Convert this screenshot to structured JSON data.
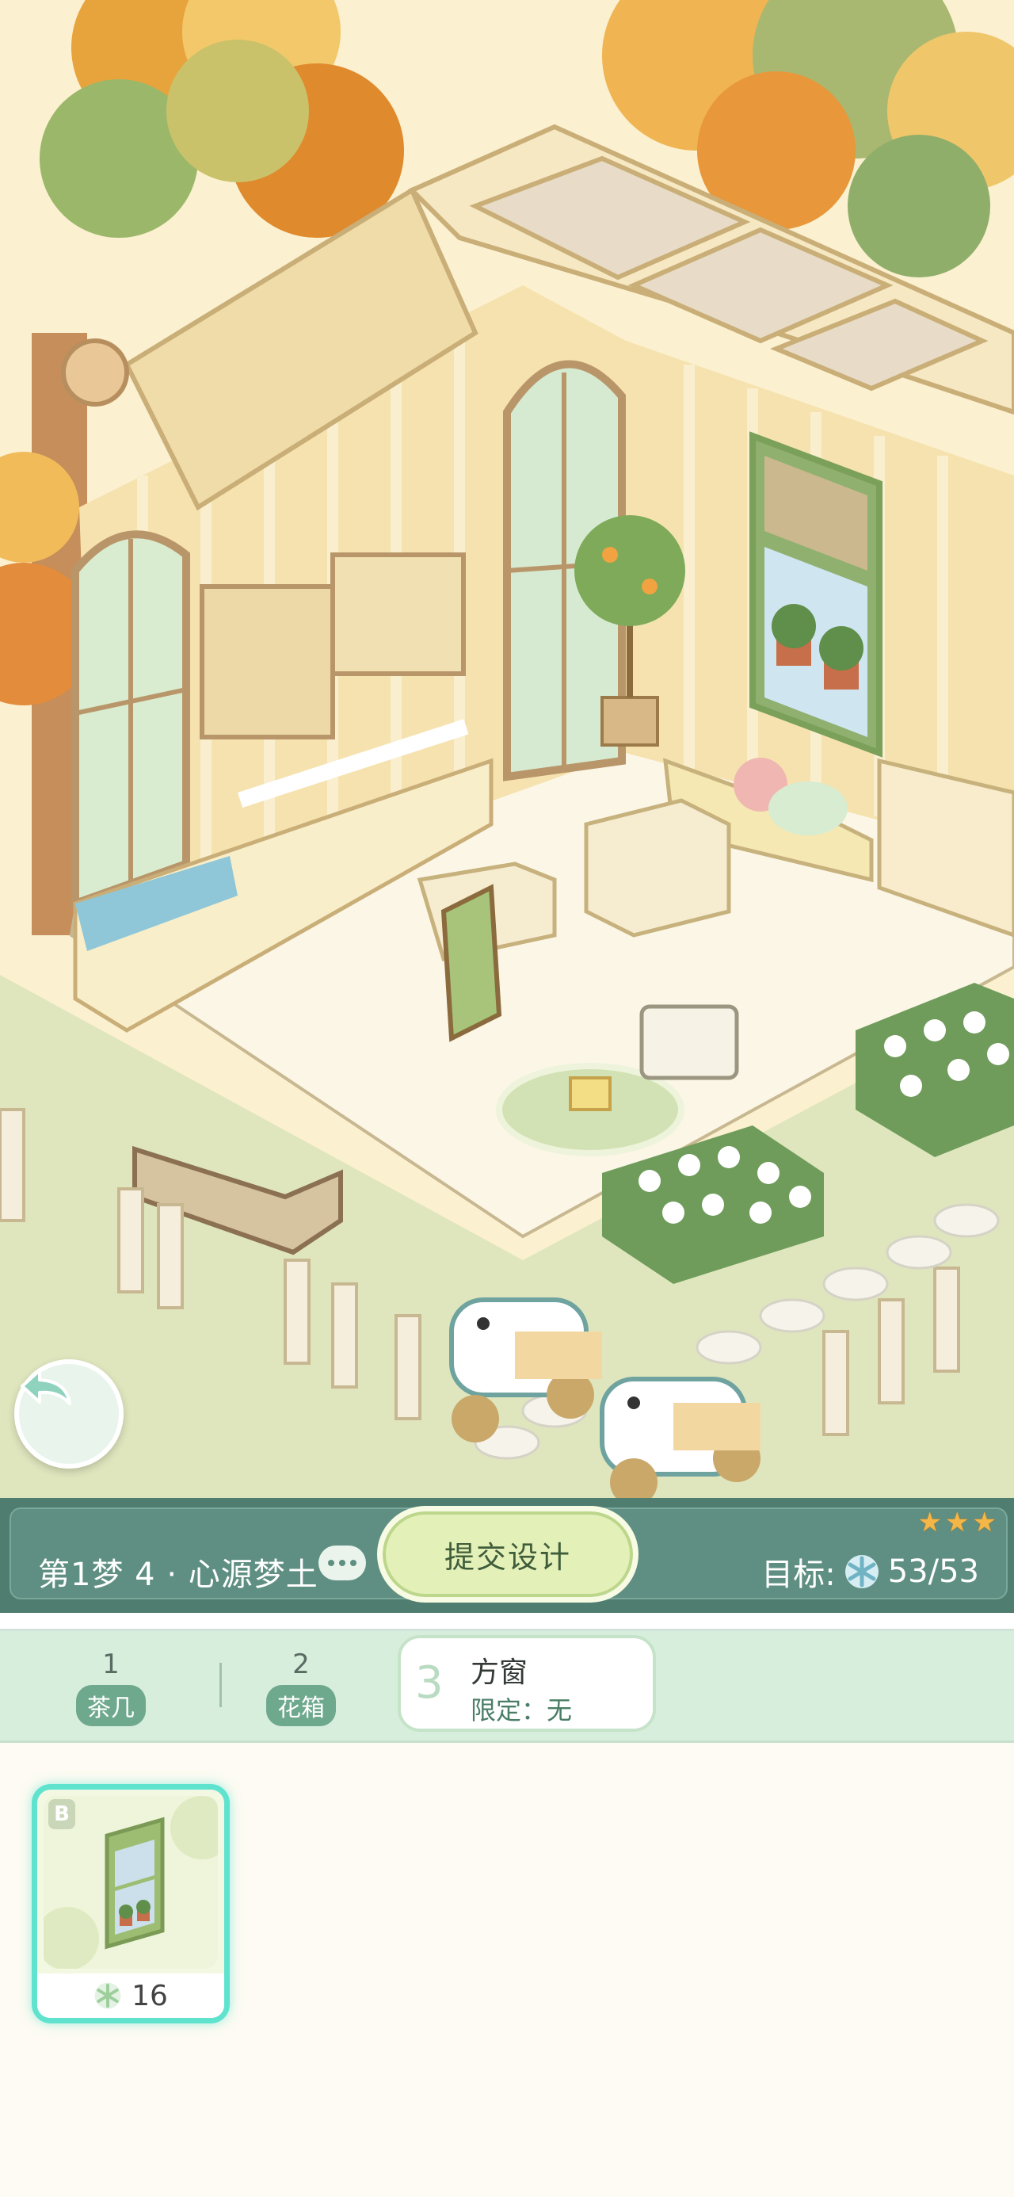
{
  "level": {
    "title": "第1梦 4 · 心源梦土",
    "submit_label": "提交设计",
    "goal_label": "目标:",
    "goal_value": "53/53",
    "stars": 3
  },
  "tabs": [
    {
      "num": "1",
      "label": "茶几"
    },
    {
      "num": "2",
      "label": "花箱"
    },
    {
      "num": "3",
      "label": "方窗",
      "limit": "限定：无",
      "active": true
    }
  ],
  "items": [
    {
      "grade": "B",
      "cost": "16",
      "icon": "window-plant-icon"
    }
  ],
  "colors": {
    "bar": "#5f8f82",
    "submit": "#e3f0b8",
    "tab_bg": "#d8eedd",
    "card_border": "#5fe3cf",
    "star": "#f5b648"
  }
}
